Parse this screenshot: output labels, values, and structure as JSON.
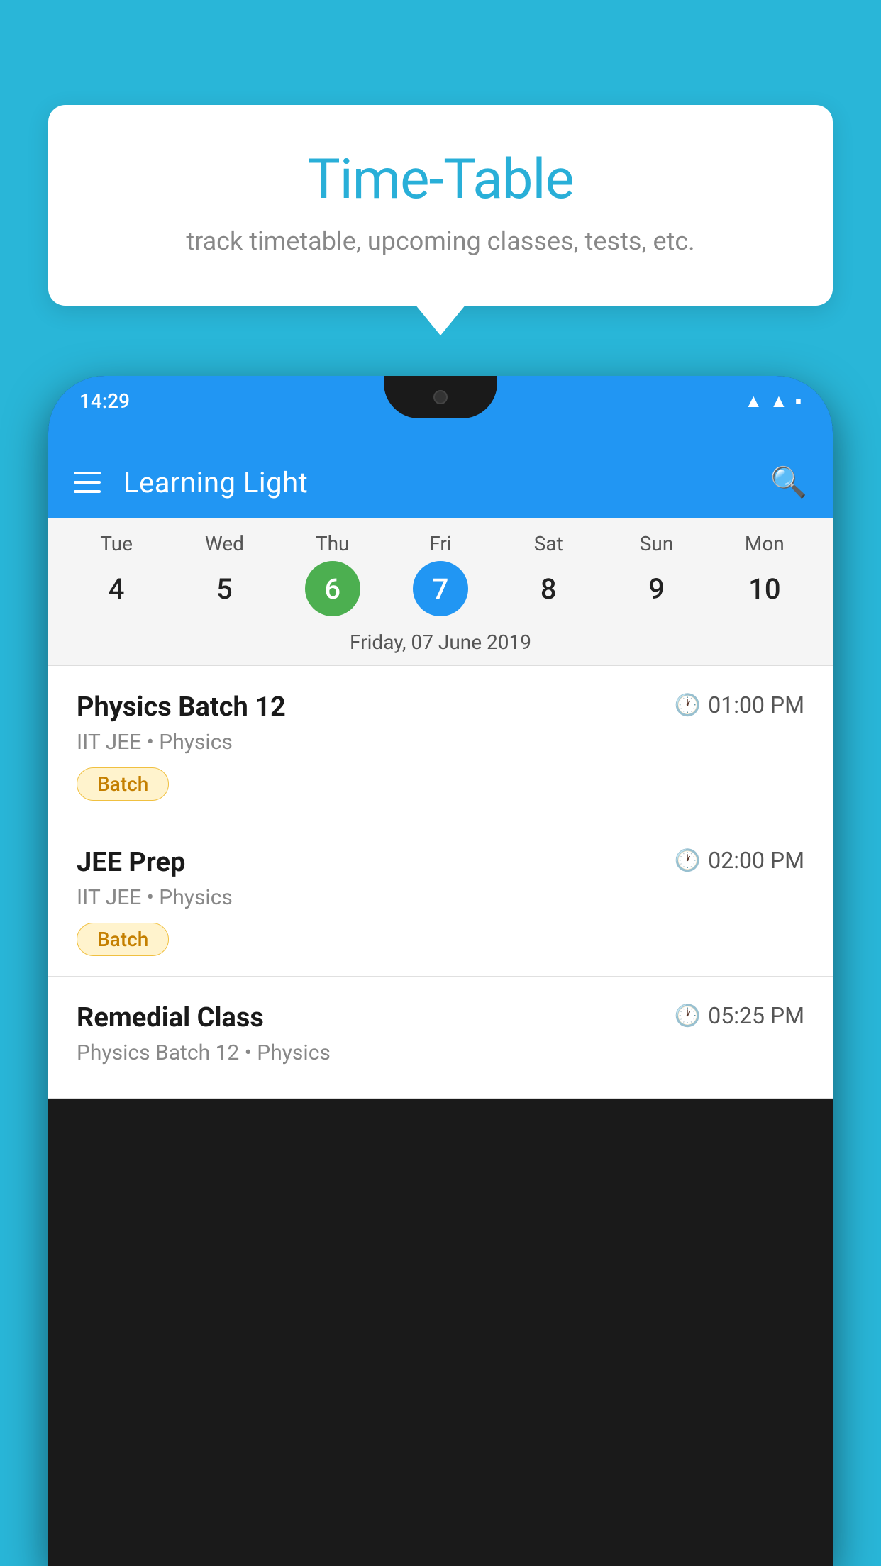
{
  "background_color": "#29b6d8",
  "tooltip": {
    "title": "Time-Table",
    "subtitle": "track timetable, upcoming classes, tests, etc."
  },
  "phone": {
    "status_bar": {
      "time": "14:29",
      "icons": [
        "wifi",
        "signal",
        "battery"
      ]
    },
    "app_bar": {
      "title": "Learning Light",
      "search_label": "search"
    },
    "calendar": {
      "days": [
        {
          "name": "Tue",
          "num": "4",
          "state": "normal"
        },
        {
          "name": "Wed",
          "num": "5",
          "state": "normal"
        },
        {
          "name": "Thu",
          "num": "6",
          "state": "today"
        },
        {
          "name": "Fri",
          "num": "7",
          "state": "selected"
        },
        {
          "name": "Sat",
          "num": "8",
          "state": "normal"
        },
        {
          "name": "Sun",
          "num": "9",
          "state": "normal"
        },
        {
          "name": "Mon",
          "num": "10",
          "state": "normal"
        }
      ],
      "selected_date_label": "Friday, 07 June 2019"
    },
    "schedule": [
      {
        "name": "Physics Batch 12",
        "time": "01:00 PM",
        "meta": "IIT JEE • Physics",
        "tag": "Batch"
      },
      {
        "name": "JEE Prep",
        "time": "02:00 PM",
        "meta": "IIT JEE • Physics",
        "tag": "Batch"
      },
      {
        "name": "Remedial Class",
        "time": "05:25 PM",
        "meta": "Physics Batch 12 • Physics",
        "tag": ""
      }
    ]
  }
}
